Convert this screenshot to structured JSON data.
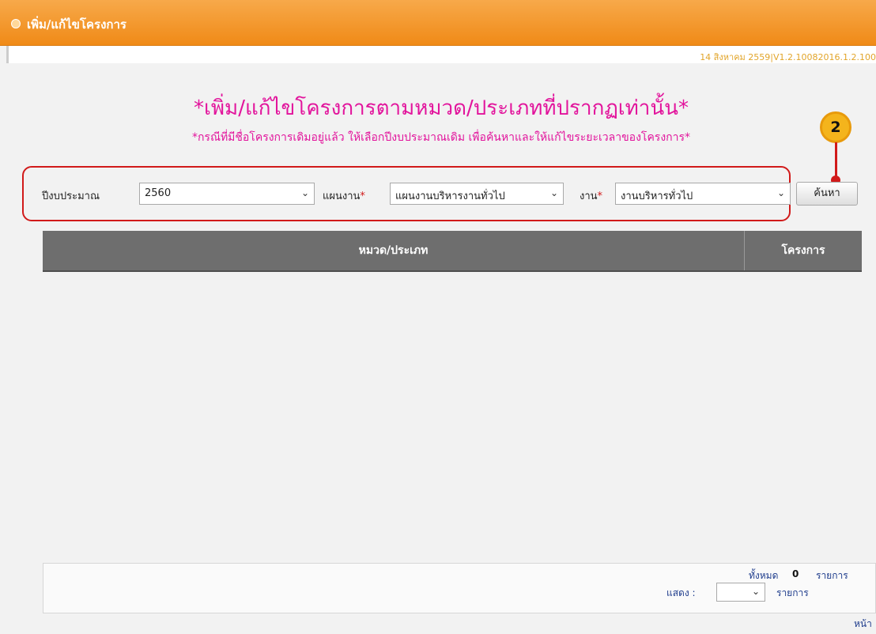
{
  "header": {
    "title": "เพิ่ม/แก้ไขโครงการ"
  },
  "version_text": "14 สิงหาคม 2559|V1.2.10082016.1.2.100",
  "heading": "*เพิ่ม/แก้ไขโครงการตามหมวด/ประเภทที่ปรากฏเท่านั้น*",
  "subnote": "*กรณีที่มีชื่อโครงการเดิมอยู่แล้ว ให้เลือกปีงบประมาณเดิม เพื่อค้นหาและให้แก้ไขระยะเวลาของโครงการ*",
  "step_badge": "2",
  "filters": {
    "budget_year": {
      "label": "ปีงบประมาณ",
      "value": "2560"
    },
    "plan": {
      "label": "แผนงาน",
      "required_mark": "*",
      "value": "แผนงานบริหารงานทั่วไป"
    },
    "work": {
      "label": "งาน",
      "required_mark": "*",
      "value": "งานบริหารทั่วไป"
    },
    "search_label": "ค้นหา"
  },
  "table": {
    "columns": [
      "หมวด/ประเภท",
      "โครงการ"
    ]
  },
  "pager": {
    "total_label": "ทั้งหมด",
    "total_count": "0",
    "items_label": "รายการ",
    "show_label": "แสดง :",
    "per_page_value": "",
    "items_label2": "รายการ",
    "page_label": "หน้า :"
  },
  "colors": {
    "header_orange": "#f08a17",
    "heading_pink": "#e2149c",
    "annotation_red": "#d11a1a",
    "badge_yellow": "#f4b41c",
    "table_header": "#6e6e6e"
  },
  "icons": {
    "dropdown": "chevron-down-icon",
    "title_bullet": "bullet-icon"
  }
}
